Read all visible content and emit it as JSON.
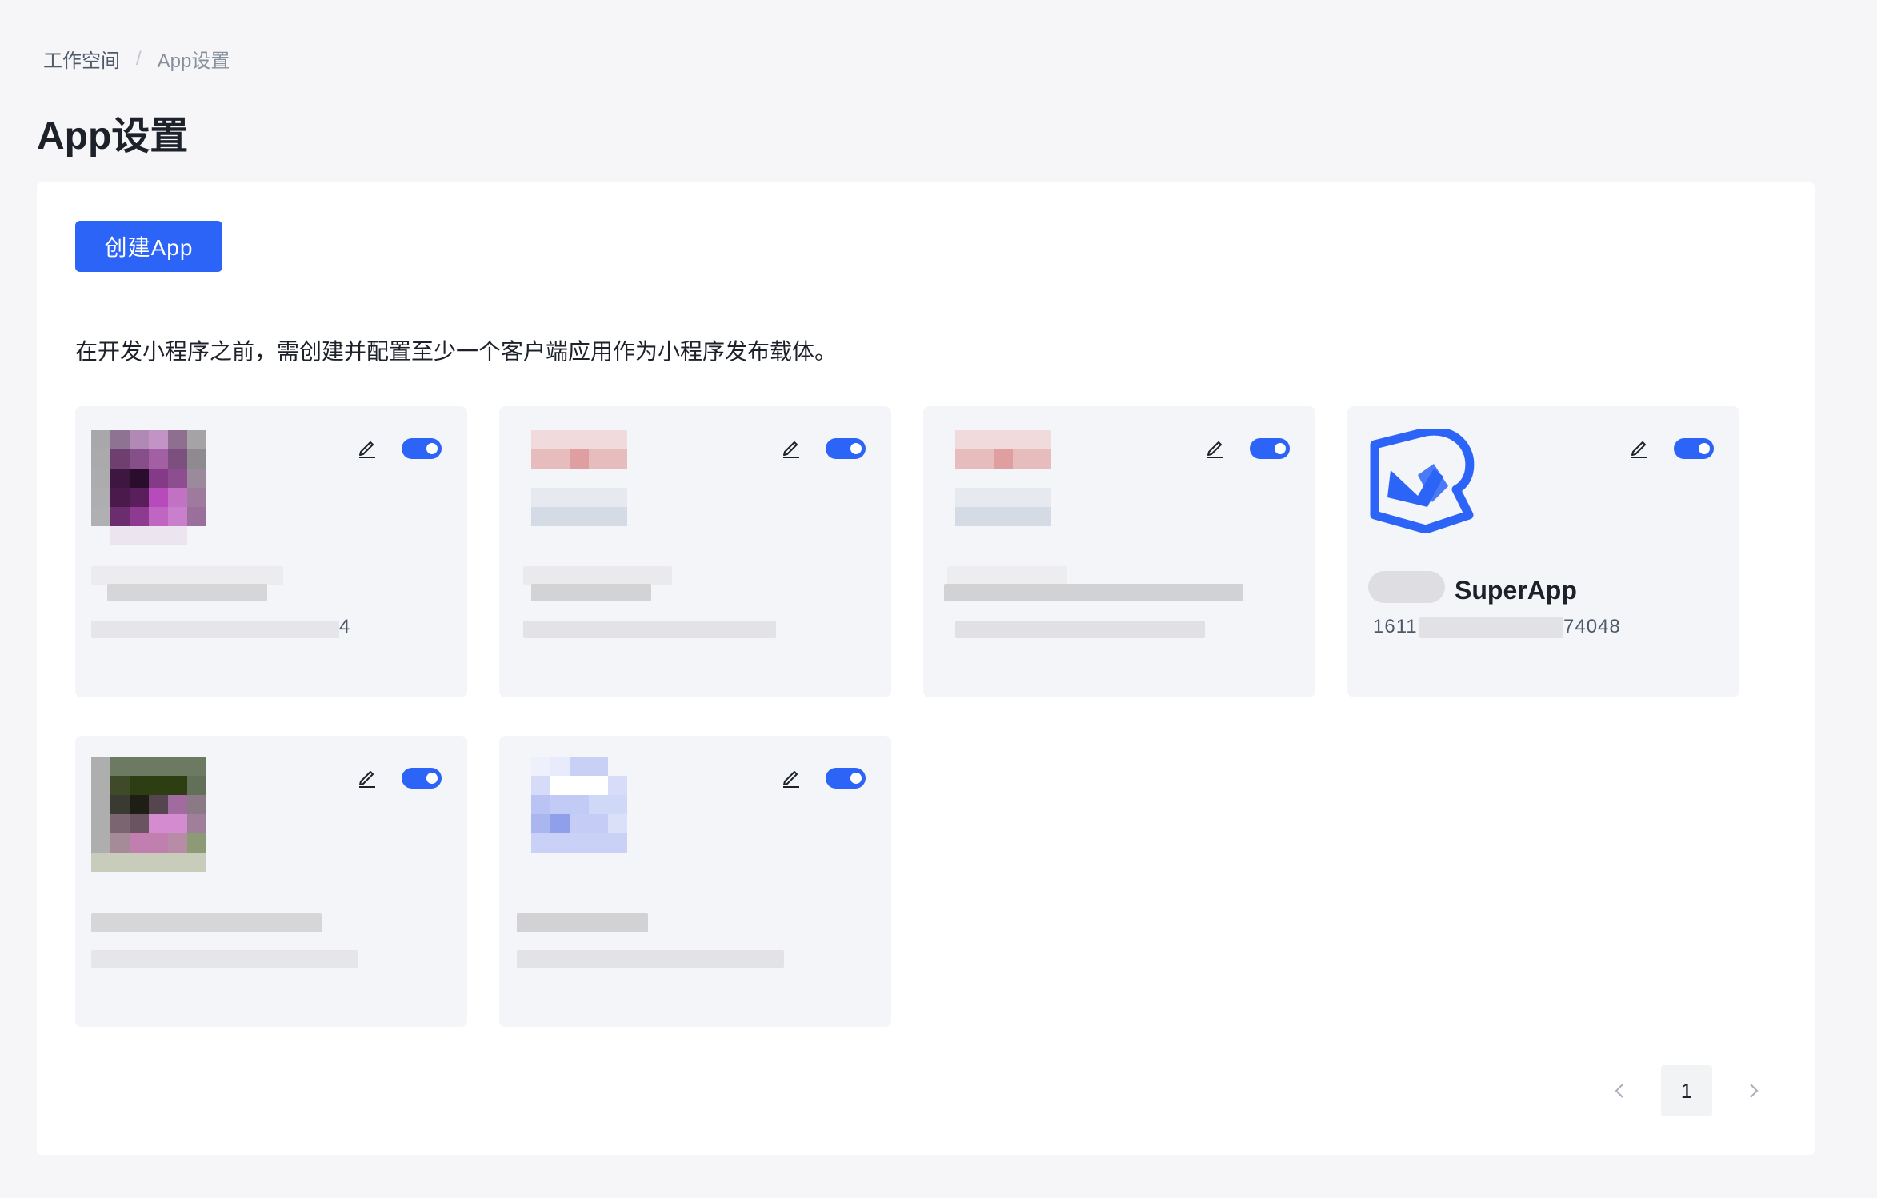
{
  "breadcrumb": {
    "root": "工作空间",
    "separator": "/",
    "current": "App设置"
  },
  "page_title": "App设置",
  "create_button": "创建App",
  "description": "在开发小程序之前，需创建并配置至少一个客户端应用作为小程序发布载体。",
  "cards": [
    {
      "name": "",
      "id_tail": "4",
      "enabled": true
    },
    {
      "name": "",
      "id_tail": "",
      "enabled": true
    },
    {
      "name": "",
      "id_tail": "",
      "enabled": true
    },
    {
      "name": "SuperApp",
      "id_head": "1611",
      "id_tail": "74048",
      "enabled": true
    },
    {
      "name": "",
      "id_tail": "",
      "enabled": true
    },
    {
      "name": "",
      "id_tail": "",
      "enabled": true
    }
  ],
  "pagination": {
    "current_page": "1",
    "prev_icon": "chevron-left-icon",
    "next_icon": "chevron-right-icon"
  },
  "colors": {
    "accent": "#2b64f6",
    "background": "#f6f6f9",
    "card_bg": "#f4f5f8"
  }
}
